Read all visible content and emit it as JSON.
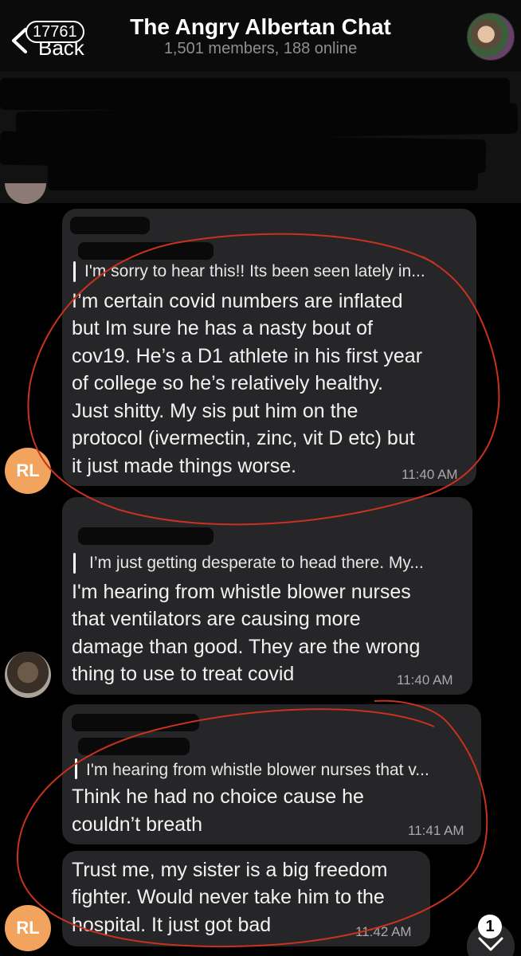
{
  "header": {
    "back_label": "Back",
    "back_badge": "17761",
    "title": "The Angry Albertan Chat",
    "subtitle": "1,501 members, 188 online"
  },
  "messages": [
    {
      "reply_text": "I'm sorry to hear this!! Its been seen lately in...",
      "lines": [
        "I’m certain covid numbers are inflated",
        "but Im sure he has a nasty bout of",
        "cov19. He’s a D1 athlete in his first year",
        "of college so he’s relatively healthy.",
        "Just shitty. My sis put him on the",
        "protocol (ivermectin, zinc, vit D etc) but",
        "it just made things worse."
      ],
      "time": "11:40 AM",
      "avatar_initials": "RL"
    },
    {
      "reply_text": "I’m just getting desperate to head there. My...",
      "lines": [
        "I'm hearing from whistle blower nurses",
        "that ventilators are causing more",
        "damage than good. They are the wrong",
        "thing to use to treat covid"
      ],
      "time": "11:40 AM"
    },
    {
      "reply_text": "I'm hearing from whistle blower nurses that v...",
      "lines": [
        "Think he had no choice cause he",
        "couldn’t breath"
      ],
      "time": "11:41 AM"
    },
    {
      "lines": [
        "Trust me, my sister is a big freedom",
        "fighter. Would never take him to the",
        "hospital. It just got bad"
      ],
      "time": "11:42 AM",
      "avatar_initials": "RL"
    }
  ],
  "scroll_button": {
    "count": "1"
  },
  "colors": {
    "background": "#000000",
    "bubble": "#262628",
    "avatar_rl": "#f2a35e",
    "annotation_red": "#c8321e"
  },
  "icons": [
    "chevron-left-icon",
    "chevron-down-icon"
  ]
}
